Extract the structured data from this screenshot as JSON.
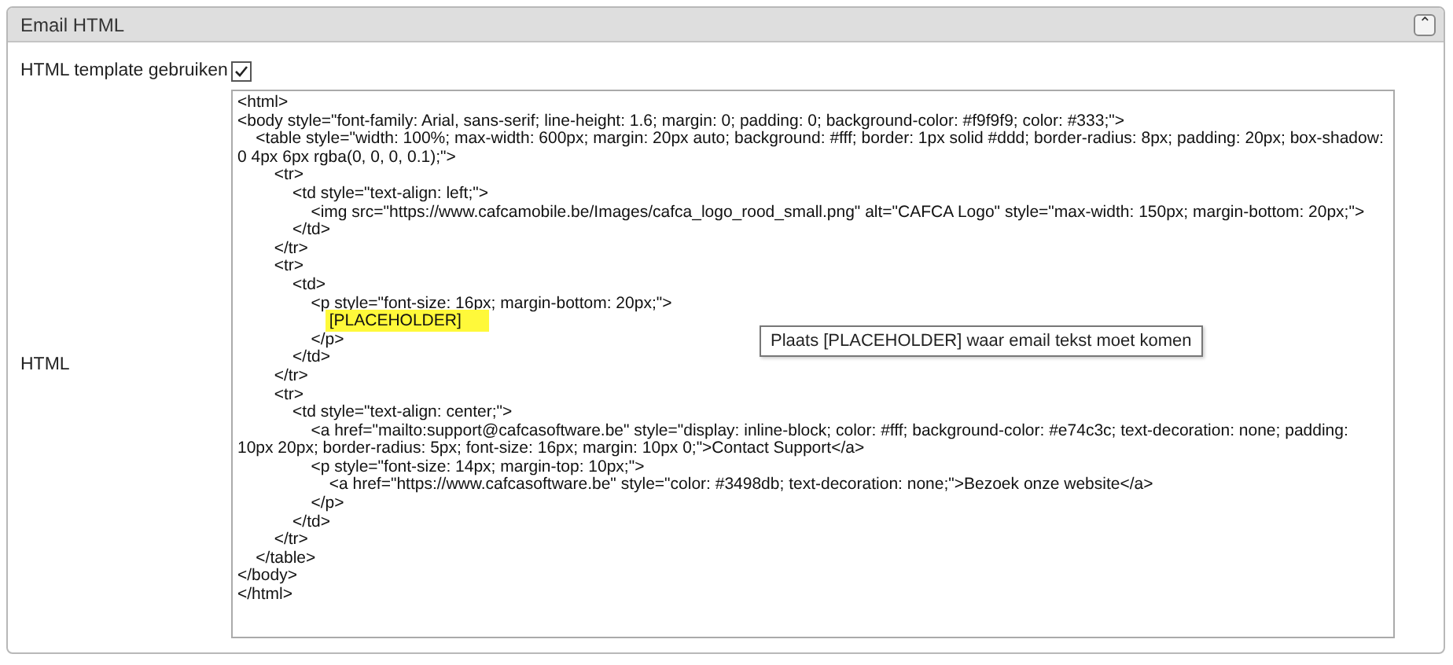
{
  "panel": {
    "title": "Email HTML",
    "collapse_icon": "⌃",
    "expanded": true
  },
  "fields": [
    {
      "kind": "checkbox",
      "label": "HTML template gebruiken",
      "checked": true
    },
    {
      "kind": "code",
      "label": "HTML",
      "lines": [
        {
          "text": "<html>",
          "highlighted": false
        },
        {
          "text": "<body style=\"font-family: Arial, sans-serif; line-height: 1.6; margin: 0; padding: 0; background-color: #f9f9f9; color: #333;\">",
          "highlighted": false
        },
        {
          "text": "    <table style=\"width: 100%; max-width: 600px; margin: 20px auto; background: #fff; border: 1px solid #ddd; border-radius: 8px; padding: 20px; box-shadow: 0 4px 6px rgba(0, 0, 0, 0.1);\">",
          "highlighted": false
        },
        {
          "text": "        <tr>",
          "highlighted": false
        },
        {
          "text": "            <td style=\"text-align: left;\">",
          "highlighted": false
        },
        {
          "text": "                <img src=\"https://www.cafcamobile.be/Images/cafca_logo_rood_small.png\" alt=\"CAFCA Logo\" style=\"max-width: 150px; margin-bottom: 20px;\">",
          "highlighted": false
        },
        {
          "text": "            </td>",
          "highlighted": false
        },
        {
          "text": "        </tr>",
          "highlighted": false
        },
        {
          "text": "        <tr>",
          "highlighted": false
        },
        {
          "text": "            <td>",
          "highlighted": false
        },
        {
          "text": "                <p style=\"font-size: 16px; margin-bottom: 20px;\">",
          "highlighted": false
        },
        {
          "text": "                    [PLACEHOLDER]",
          "highlighted": true
        },
        {
          "text": "                </p>",
          "highlighted": false
        },
        {
          "text": "            </td>",
          "highlighted": false
        },
        {
          "text": "        </tr>",
          "highlighted": false
        },
        {
          "text": "        <tr>",
          "highlighted": false
        },
        {
          "text": "            <td style=\"text-align: center;\">",
          "highlighted": false
        },
        {
          "text": "                <a href=\"mailto:support@cafcasoftware.be\" style=\"display: inline-block; color: #fff; background-color: #e74c3c; text-decoration: none; padding: 10px 20px; border-radius: 5px; font-size: 16px; margin: 10px 0;\">Contact Support</a>",
          "highlighted": false
        },
        {
          "text": "                <p style=\"font-size: 14px; margin-top: 10px;\">",
          "highlighted": false
        },
        {
          "text": "                    <a href=\"https://www.cafcasoftware.be\" style=\"color: #3498db; text-decoration: none;\">Bezoek onze website</a>",
          "highlighted": false
        },
        {
          "text": "                </p>",
          "highlighted": false
        },
        {
          "text": "            </td>",
          "highlighted": false
        },
        {
          "text": "        </tr>",
          "highlighted": false
        },
        {
          "text": "    </table>",
          "highlighted": false
        },
        {
          "text": "</body>",
          "highlighted": false
        },
        {
          "text": "</html>",
          "highlighted": false
        }
      ],
      "tooltip": "Plaats [PLACEHOLDER] waar email tekst moet komen"
    }
  ]
}
